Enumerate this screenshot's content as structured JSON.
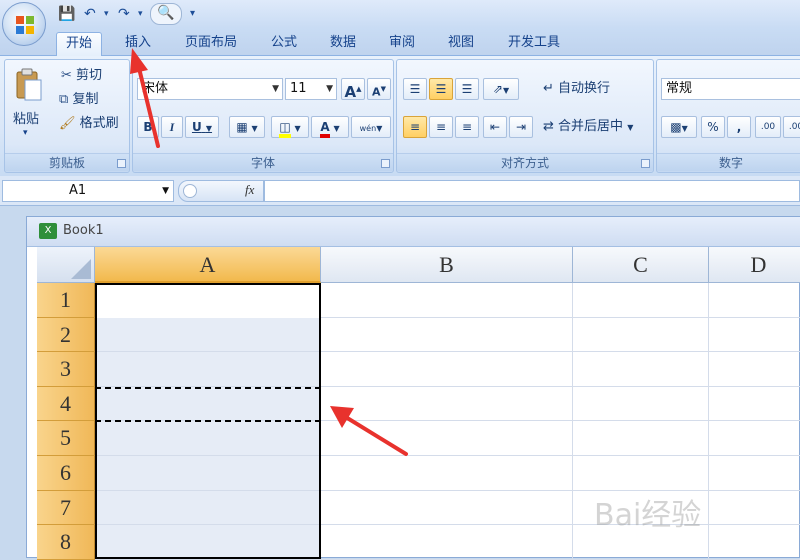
{
  "quick_access": {
    "icons": [
      "save-icon",
      "undo-icon",
      "redo-icon",
      "print-preview-icon",
      "customize-icon"
    ]
  },
  "tabs": [
    {
      "label": "开始",
      "active": true
    },
    {
      "label": "插入"
    },
    {
      "label": "页面布局"
    },
    {
      "label": "公式"
    },
    {
      "label": "数据"
    },
    {
      "label": "审阅"
    },
    {
      "label": "视图"
    },
    {
      "label": "开发工具"
    }
  ],
  "clipboard": {
    "paste": "粘贴",
    "cut": "剪切",
    "copy": "复制",
    "format_painter": "格式刷",
    "group": "剪贴板"
  },
  "font": {
    "name": "宋体",
    "size": "11",
    "bold": "B",
    "italic": "I",
    "underline": "U",
    "wen": "wén",
    "group": "字体"
  },
  "alignment": {
    "wrap": "自动换行",
    "merge": "合并后居中",
    "group": "对齐方式"
  },
  "number": {
    "format": "常规",
    "percent": "%",
    "comma": ",",
    "group": "数字"
  },
  "formula_bar": {
    "name_box": "A1",
    "fx": "fx",
    "value": ""
  },
  "workbook": {
    "title": "Book1",
    "columns": [
      "A",
      "B",
      "C",
      "D"
    ],
    "rows": [
      "1",
      "2",
      "3",
      "4",
      "5",
      "6",
      "7",
      "8"
    ]
  },
  "colors": {
    "accent": "#f0b858",
    "ribbon": "#dce8f8",
    "annotation": "#e8322d"
  },
  "watermark": "Bai经验"
}
